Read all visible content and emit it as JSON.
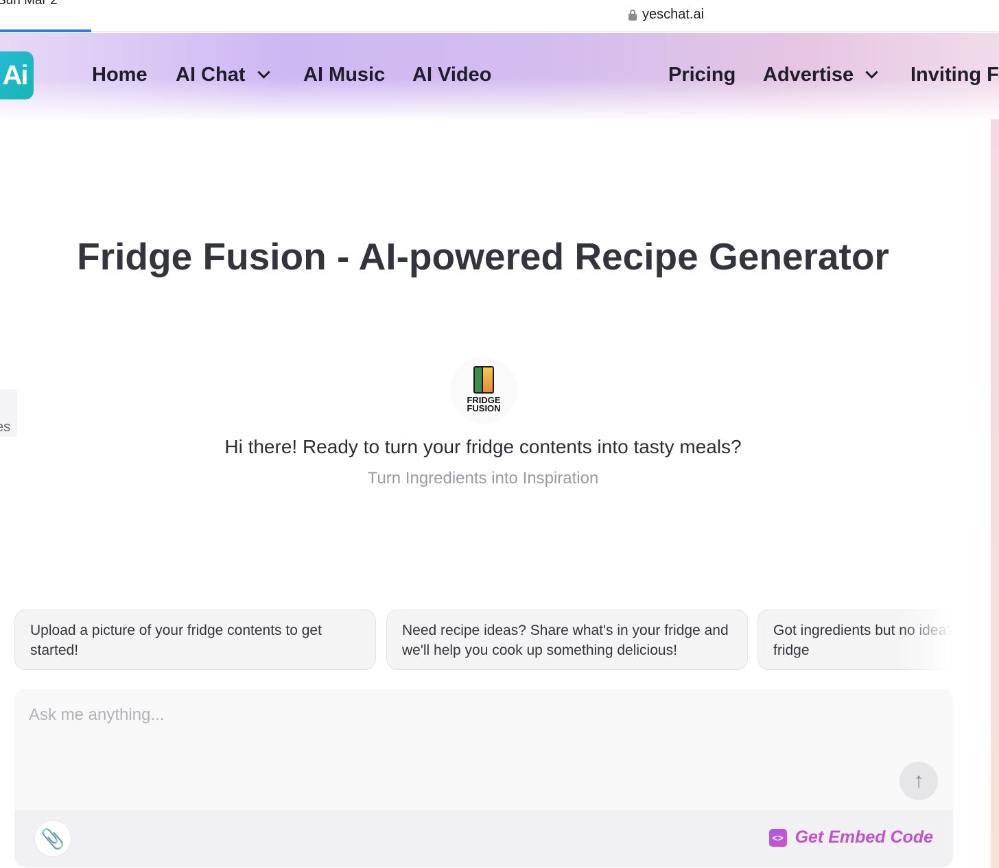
{
  "browser": {
    "tab_text": "Sun Mar 2",
    "url": "yeschat.ai"
  },
  "nav": {
    "logo_text": "Ai",
    "items": [
      {
        "label": "Home"
      },
      {
        "label": "AI Chat"
      },
      {
        "label": "AI Music"
      },
      {
        "label": "AI Video"
      },
      {
        "label": "Pricing"
      },
      {
        "label": "Advertise"
      },
      {
        "label": "Inviting Fr"
      }
    ]
  },
  "side_tab": {
    "label": "es"
  },
  "page": {
    "title": "Fridge Fusion - AI-powered Recipe Generator",
    "avatar_line1": "FRIDGE",
    "avatar_line2": "FUSION",
    "greeting": "Hi there! Ready to turn your fridge contents into tasty meals?",
    "subtitle": "Turn Ingredients into Inspiration"
  },
  "suggestions": [
    {
      "text": "Upload a picture of your fridge contents to get started!"
    },
    {
      "text": "Need recipe ideas? Share what's in your fridge and we'll help you cook up something delicious!"
    },
    {
      "text": "Got ingredients but no idea? Snap a photo of your fridge"
    }
  ],
  "composer": {
    "placeholder": "Ask me anything...",
    "embed_label": "Get Embed Code"
  },
  "colors": {
    "accent": "#c44fcf",
    "tab_indicator": "#2a7be4",
    "logo": "#17b7b0"
  }
}
